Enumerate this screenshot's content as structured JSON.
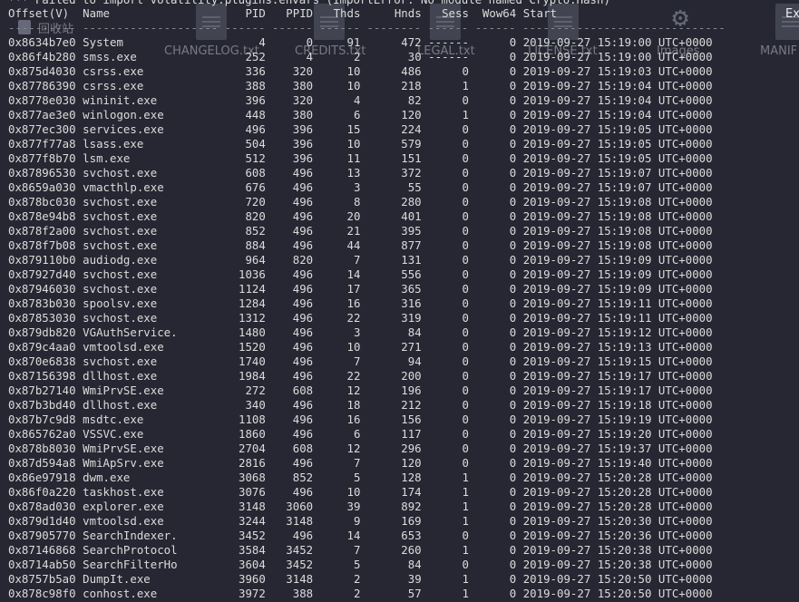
{
  "desktop": {
    "recycle_label": "回收站",
    "icons": [
      "CHANGELOG.txt",
      "CREDITS.txt",
      "LEGAL.txt",
      "LICENSE.txt",
      "Images",
      "MANIF",
      "Ex"
    ]
  },
  "terminal": {
    "warning": "*** Failed to import volatility.plugins.envars (ImportError: No module named Crypto.Hash)",
    "headers": [
      "Offset(V)",
      "Name",
      "PID",
      "PPID",
      "Thds",
      "Hnds",
      "Sess",
      "Wow64",
      "Start"
    ],
    "separator": "---------- -------------------- ------ ------ ------ -------- ------ ------ ------------------------------",
    "rows": [
      [
        "0x8634b7e0",
        "System",
        "4",
        "0",
        "91",
        "472",
        "------",
        "0",
        "2019-09-27 15:19:00 UTC+0000"
      ],
      [
        "0x86f4b280",
        "smss.exe",
        "252",
        "4",
        "2",
        "30",
        "------",
        "0",
        "2019-09-27 15:19:00 UTC+0000"
      ],
      [
        "0x875d4030",
        "csrss.exe",
        "336",
        "320",
        "10",
        "486",
        "0",
        "0",
        "2019-09-27 15:19:03 UTC+0000"
      ],
      [
        "0x87786390",
        "csrss.exe",
        "388",
        "380",
        "10",
        "218",
        "1",
        "0",
        "2019-09-27 15:19:04 UTC+0000"
      ],
      [
        "0x8778e030",
        "wininit.exe",
        "396",
        "320",
        "4",
        "82",
        "0",
        "0",
        "2019-09-27 15:19:04 UTC+0000"
      ],
      [
        "0x877ae3e0",
        "winlogon.exe",
        "448",
        "380",
        "6",
        "120",
        "1",
        "0",
        "2019-09-27 15:19:04 UTC+0000"
      ],
      [
        "0x877ec300",
        "services.exe",
        "496",
        "396",
        "15",
        "224",
        "0",
        "0",
        "2019-09-27 15:19:05 UTC+0000"
      ],
      [
        "0x877f77a8",
        "lsass.exe",
        "504",
        "396",
        "10",
        "579",
        "0",
        "0",
        "2019-09-27 15:19:05 UTC+0000"
      ],
      [
        "0x877f8b70",
        "lsm.exe",
        "512",
        "396",
        "11",
        "151",
        "0",
        "0",
        "2019-09-27 15:19:05 UTC+0000"
      ],
      [
        "0x87896530",
        "svchost.exe",
        "608",
        "496",
        "13",
        "372",
        "0",
        "0",
        "2019-09-27 15:19:07 UTC+0000"
      ],
      [
        "0x8659a030",
        "vmacthlp.exe",
        "676",
        "496",
        "3",
        "55",
        "0",
        "0",
        "2019-09-27 15:19:07 UTC+0000"
      ],
      [
        "0x878bc030",
        "svchost.exe",
        "720",
        "496",
        "8",
        "280",
        "0",
        "0",
        "2019-09-27 15:19:08 UTC+0000"
      ],
      [
        "0x878e94b8",
        "svchost.exe",
        "820",
        "496",
        "20",
        "401",
        "0",
        "0",
        "2019-09-27 15:19:08 UTC+0000"
      ],
      [
        "0x878f2a00",
        "svchost.exe",
        "852",
        "496",
        "21",
        "395",
        "0",
        "0",
        "2019-09-27 15:19:08 UTC+0000"
      ],
      [
        "0x878f7b08",
        "svchost.exe",
        "884",
        "496",
        "44",
        "877",
        "0",
        "0",
        "2019-09-27 15:19:08 UTC+0000"
      ],
      [
        "0x879110b0",
        "audiodg.exe",
        "964",
        "820",
        "7",
        "131",
        "0",
        "0",
        "2019-09-27 15:19:09 UTC+0000"
      ],
      [
        "0x87927d40",
        "svchost.exe",
        "1036",
        "496",
        "14",
        "556",
        "0",
        "0",
        "2019-09-27 15:19:09 UTC+0000"
      ],
      [
        "0x87946030",
        "svchost.exe",
        "1124",
        "496",
        "17",
        "365",
        "0",
        "0",
        "2019-09-27 15:19:09 UTC+0000"
      ],
      [
        "0x8783b030",
        "spoolsv.exe",
        "1284",
        "496",
        "16",
        "316",
        "0",
        "0",
        "2019-09-27 15:19:11 UTC+0000"
      ],
      [
        "0x87853030",
        "svchost.exe",
        "1312",
        "496",
        "22",
        "319",
        "0",
        "0",
        "2019-09-27 15:19:11 UTC+0000"
      ],
      [
        "0x879db820",
        "VGAuthService.",
        "1480",
        "496",
        "3",
        "84",
        "0",
        "0",
        "2019-09-27 15:19:12 UTC+0000"
      ],
      [
        "0x879c4aa0",
        "vmtoolsd.exe",
        "1520",
        "496",
        "10",
        "271",
        "0",
        "0",
        "2019-09-27 15:19:13 UTC+0000"
      ],
      [
        "0x870e6838",
        "svchost.exe",
        "1740",
        "496",
        "7",
        "94",
        "0",
        "0",
        "2019-09-27 15:19:15 UTC+0000"
      ],
      [
        "0x87156398",
        "dllhost.exe",
        "1984",
        "496",
        "22",
        "200",
        "0",
        "0",
        "2019-09-27 15:19:17 UTC+0000"
      ],
      [
        "0x87b27140",
        "WmiPrvSE.exe",
        "272",
        "608",
        "12",
        "196",
        "0",
        "0",
        "2019-09-27 15:19:17 UTC+0000"
      ],
      [
        "0x87b3bd40",
        "dllhost.exe",
        "340",
        "496",
        "18",
        "212",
        "0",
        "0",
        "2019-09-27 15:19:18 UTC+0000"
      ],
      [
        "0x87b7c9d8",
        "msdtc.exe",
        "1108",
        "496",
        "16",
        "156",
        "0",
        "0",
        "2019-09-27 15:19:19 UTC+0000"
      ],
      [
        "0x865762a0",
        "VSSVC.exe",
        "1860",
        "496",
        "6",
        "117",
        "0",
        "0",
        "2019-09-27 15:19:20 UTC+0000"
      ],
      [
        "0x878b8030",
        "WmiPrvSE.exe",
        "2704",
        "608",
        "12",
        "296",
        "0",
        "0",
        "2019-09-27 15:19:37 UTC+0000"
      ],
      [
        "0x87d594a8",
        "WmiApSrv.exe",
        "2816",
        "496",
        "7",
        "120",
        "0",
        "0",
        "2019-09-27 15:19:40 UTC+0000"
      ],
      [
        "0x86e97918",
        "dwm.exe",
        "3068",
        "852",
        "5",
        "128",
        "1",
        "0",
        "2019-09-27 15:20:28 UTC+0000"
      ],
      [
        "0x86f0a220",
        "taskhost.exe",
        "3076",
        "496",
        "10",
        "174",
        "1",
        "0",
        "2019-09-27 15:20:28 UTC+0000"
      ],
      [
        "0x878ad030",
        "explorer.exe",
        "3148",
        "3060",
        "39",
        "892",
        "1",
        "0",
        "2019-09-27 15:20:28 UTC+0000"
      ],
      [
        "0x879d1d40",
        "vmtoolsd.exe",
        "3244",
        "3148",
        "9",
        "169",
        "1",
        "0",
        "2019-09-27 15:20:30 UTC+0000"
      ],
      [
        "0x87905770",
        "SearchIndexer.",
        "3452",
        "496",
        "14",
        "653",
        "0",
        "0",
        "2019-09-27 15:20:36 UTC+0000"
      ],
      [
        "0x87146868",
        "SearchProtocol",
        "3584",
        "3452",
        "7",
        "260",
        "1",
        "0",
        "2019-09-27 15:20:38 UTC+0000"
      ],
      [
        "0x8714ab50",
        "SearchFilterHo",
        "3604",
        "3452",
        "5",
        "84",
        "0",
        "0",
        "2019-09-27 15:20:38 UTC+0000"
      ],
      [
        "0x8757b5a0",
        "DumpIt.exe",
        "3960",
        "3148",
        "2",
        "39",
        "1",
        "0",
        "2019-09-27 15:20:50 UTC+0000"
      ],
      [
        "0x878c98f0",
        "conhost.exe",
        "3972",
        "388",
        "2",
        "57",
        "1",
        "0",
        "2019-09-27 15:20:50 UTC+0000"
      ]
    ]
  }
}
